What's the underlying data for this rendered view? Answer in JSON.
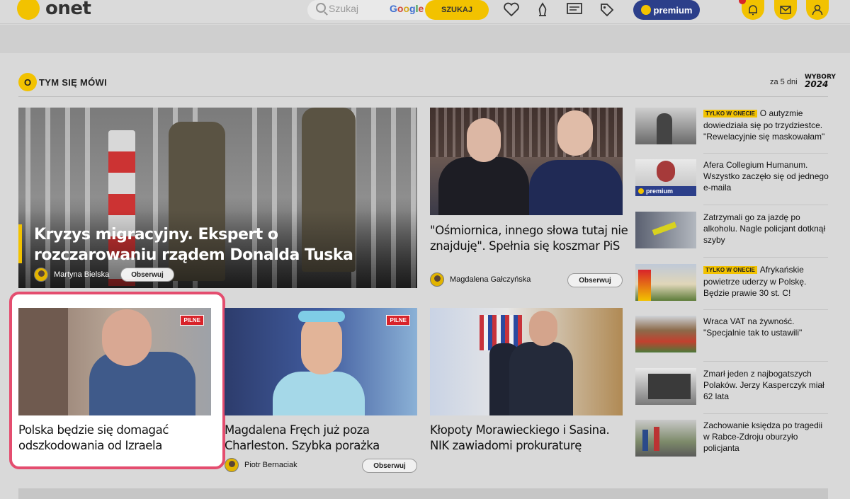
{
  "header": {
    "logo_text": "onet",
    "search_placeholder": "Szukaj",
    "google_letters": [
      "G",
      "o",
      "o",
      "g",
      "l",
      "e"
    ],
    "search_button": "SZUKAJ",
    "premium_label": "premium"
  },
  "section": {
    "badge_letter": "O",
    "title": "TYM SIĘ MÓWI",
    "days_label": "za 5 dni",
    "wybory_top": "WYBORY",
    "wybory_year": "2024"
  },
  "main_article": {
    "title": "Kryzys migracyjny. Ekspert o rozczarowaniu rządem Donalda Tuska",
    "author": "Martyna Bielska",
    "follow": "Obserwuj"
  },
  "top_card": {
    "title": "\"Ośmiornica, innego słowa tutaj nie znajduję\". Spełnia się koszmar PiS",
    "author": "Magdalena Gałczyńska",
    "follow": "Obserwuj"
  },
  "bottom_cards": [
    {
      "title": "Polska będzie się domagać odszkodowania od Izraela",
      "badge": "PILNE"
    },
    {
      "title": "Magdalena Fręch już poza Charleston. Szybka porażka",
      "badge": "PILNE",
      "author": "Piotr Bernaciak",
      "follow": "Obserwuj"
    },
    {
      "title": "Kłopoty Morawieckiego i Sasina. NIK zawiadomi prokuraturę"
    }
  ],
  "sidebar": [
    {
      "badge": "TYLKO W ONECIE",
      "text": "O autyzmie dowiedziała się po trzydziestce. \"Rewelacyjnie się maskowałam\""
    },
    {
      "text": "Afera Collegium Humanum. Wszystko zaczęło się od jednego e-maila",
      "premium": "premium"
    },
    {
      "text": "Zatrzymali go za jazdę po alkoholu. Nagle policjant dotknął szyby"
    },
    {
      "badge": "TYLKO W ONECIE",
      "text": "Afrykańskie powietrze uderzy w Polskę. Będzie prawie 30 st. C!"
    },
    {
      "text": "Wraca VAT na żywność. \"Specjalnie tak to ustawili\""
    },
    {
      "text": "Zmarł jeden z najbogatszych Polaków. Jerzy Kasperczyk miał 62 lata"
    },
    {
      "text": "Zachowanie księdza po tragedii w Rabce-Zdroju oburzyło policjanta"
    }
  ],
  "colors": {
    "accent": "#f2c200",
    "premium": "#2c3f8a",
    "pilne": "#d8232a",
    "highlight": "#e44d6f"
  }
}
